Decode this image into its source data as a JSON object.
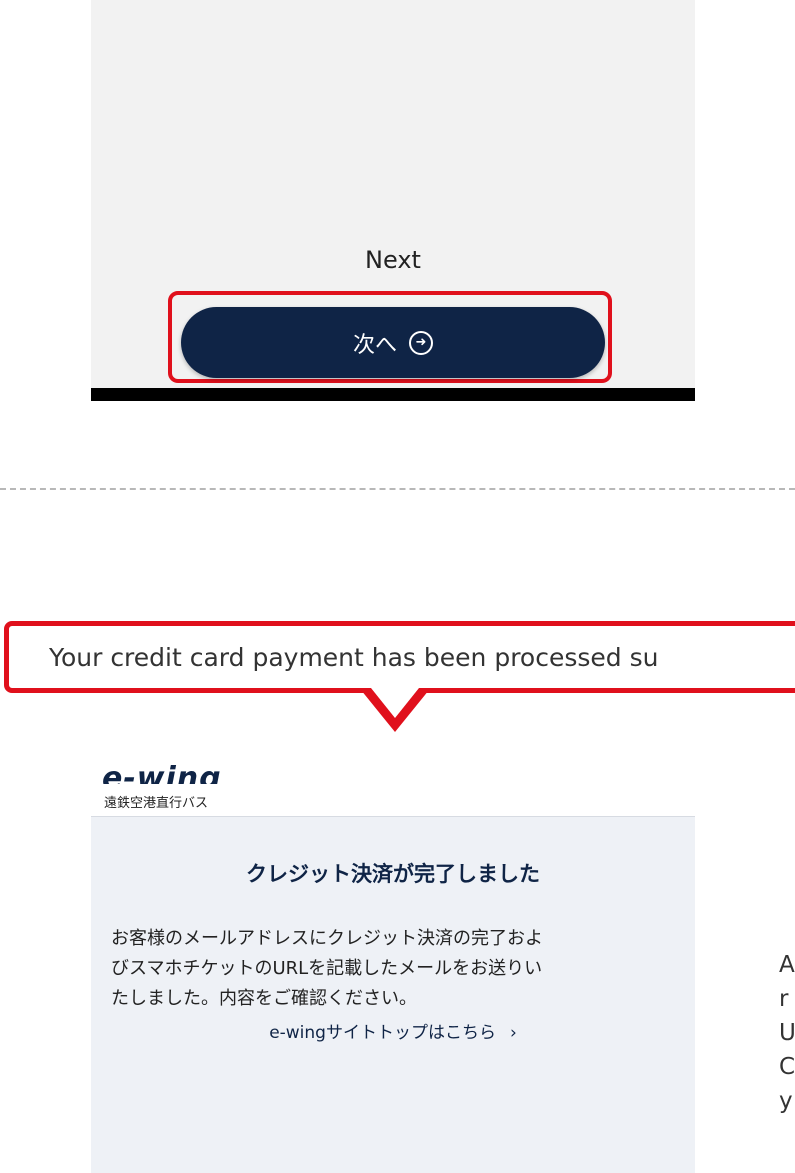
{
  "top": {
    "caption": "Next",
    "button_label": "次へ",
    "button_icon": "arrow-right-circle-icon"
  },
  "callout": {
    "text": "Your credit card payment has been processed su"
  },
  "brand": {
    "logo": "e-wing",
    "subtitle": "遠鉄空港直行バス"
  },
  "card": {
    "title": "クレジット決済が完了しました",
    "body_lines": [
      "お客様のメールアドレスにクレジット決済の完了およ",
      "びスマホチケットのURLを記載したメールをお送りい",
      "たしました。内容をご確認ください。"
    ],
    "link": "e-wingサイトトップはこちら",
    "link_chevron": "›"
  },
  "side": {
    "lines": [
      "A",
      "r",
      "U",
      "C",
      "y"
    ]
  },
  "colors": {
    "highlight": "#e0101c",
    "navy": "#0f2446",
    "card_bg": "#eef1f6"
  }
}
